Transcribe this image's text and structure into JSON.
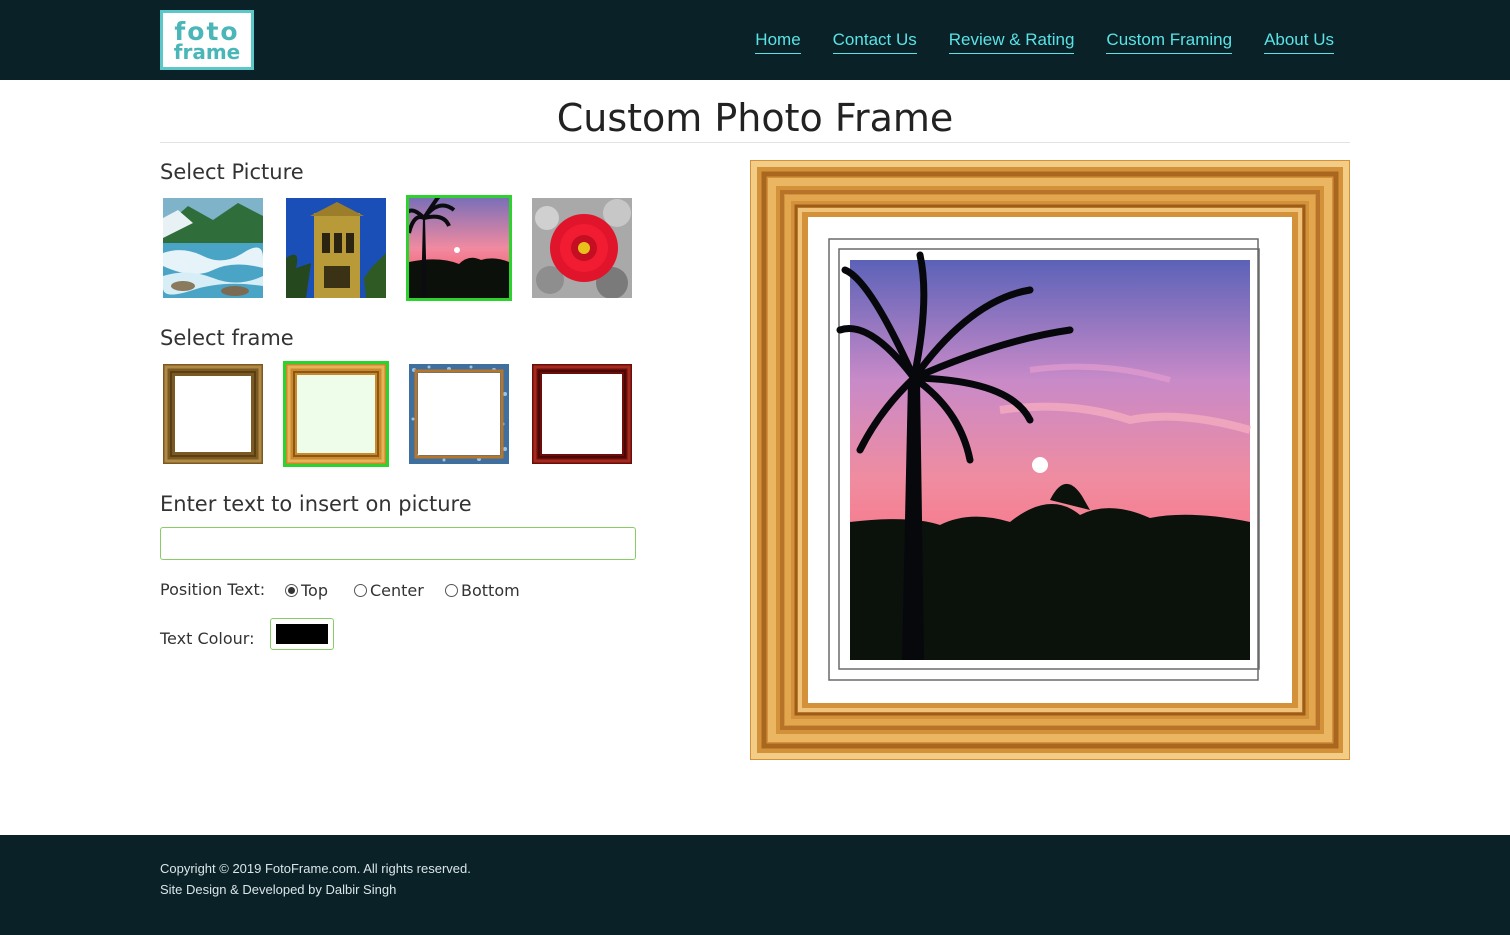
{
  "logo": {
    "line1": "foto",
    "line2": "frame"
  },
  "nav": [
    "Home",
    "Contact Us",
    "Review & Rating",
    "Custom Framing",
    "About Us"
  ],
  "title": "Custom Photo Frame",
  "select_picture": {
    "label": "Select Picture",
    "pictures": [
      "river-photo",
      "church-tower-photo",
      "sunset-palm-photo",
      "red-flower-photo"
    ],
    "selected_index": 2
  },
  "select_frame": {
    "label": "Select frame",
    "frames": [
      "brown-wood-frame",
      "golden-wood-frame",
      "blue-stone-frame",
      "red-wood-frame"
    ],
    "selected_index": 1
  },
  "text_section": {
    "label": "Enter text to insert on picture",
    "value": "",
    "placeholder": ""
  },
  "position": {
    "label": "Position Text:",
    "options": [
      "Top",
      "Center",
      "Bottom"
    ],
    "selected": "Top"
  },
  "text_colour": {
    "label": "Text Colour:",
    "value": "#000000"
  },
  "footer": {
    "copyright": "Copyright © 2019 FotoFrame.com. All rights reserved.",
    "credit": "Site Design & Developed by Dalbir Singh"
  },
  "colors": {
    "header_bg": "#0a2127",
    "nav_link": "#59e3e6",
    "selected_outline": "#2fd12f",
    "logo_accent": "#4bb6b8"
  }
}
